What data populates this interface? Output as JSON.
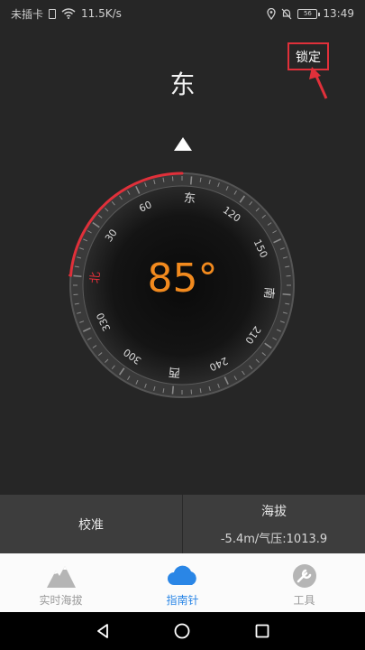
{
  "status": {
    "carrier": "未插卡",
    "speed": "11.5K/s",
    "battery": "56",
    "time": "13:49"
  },
  "direction": "东",
  "lock_label": "锁定",
  "compass": {
    "heading": 85,
    "degree_text": "85°",
    "labels": [
      {
        "text": "北",
        "angle": 0
      },
      {
        "text": "30",
        "angle": 30
      },
      {
        "text": "60",
        "angle": 60
      },
      {
        "text": "东",
        "angle": 90
      },
      {
        "text": "120",
        "angle": 120
      },
      {
        "text": "150",
        "angle": 150
      },
      {
        "text": "南",
        "angle": 180
      },
      {
        "text": "210",
        "angle": 210
      },
      {
        "text": "240",
        "angle": 240
      },
      {
        "text": "西",
        "angle": 270
      },
      {
        "text": "300",
        "angle": 300
      },
      {
        "text": "330",
        "angle": 330
      }
    ],
    "accent_color": "#e0303a",
    "readout_color": "#f28a1e"
  },
  "info": {
    "calibrate": "校准",
    "altitude_label": "海拔",
    "altitude_value": "-5.4m/气压:1013.9"
  },
  "tabs": [
    {
      "label": "实时海拔",
      "icon": "mountain-icon"
    },
    {
      "label": "指南针",
      "icon": "cloud-icon"
    },
    {
      "label": "工具",
      "icon": "tools-icon"
    }
  ]
}
